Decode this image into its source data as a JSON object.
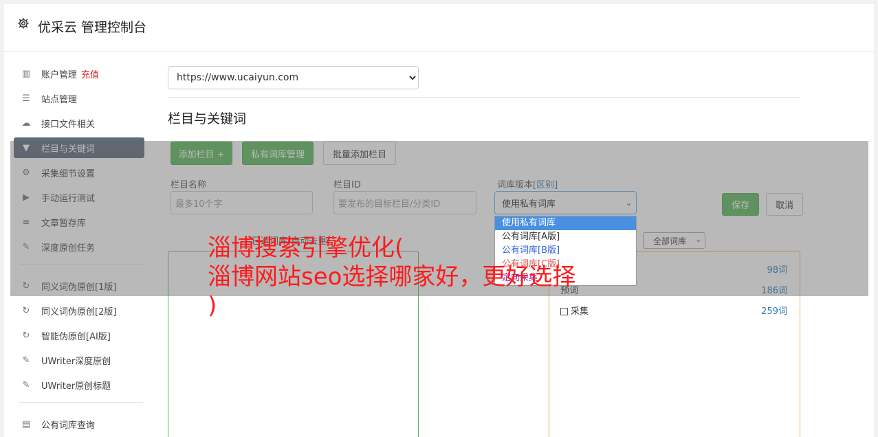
{
  "header": {
    "title": "优采云 管理控制台",
    "icon": "gear-icon"
  },
  "sidebar": {
    "items": [
      {
        "label": "账户管理",
        "badge": "充值",
        "icon": "bar-chart-icon"
      },
      {
        "label": "站点管理",
        "icon": "server-icon"
      },
      {
        "label": "接口文件相关",
        "icon": "cloud-upload-icon"
      },
      {
        "label": "栏目与关键词",
        "icon": "filter-icon",
        "active": true
      },
      {
        "label": "采集细节设置",
        "icon": "gears-icon"
      },
      {
        "label": "手动运行测试",
        "icon": "play-icon"
      },
      {
        "label": "文章暂存库",
        "icon": "database-icon"
      },
      {
        "label": "深度原创任务",
        "icon": "edit-icon"
      }
    ],
    "items2": [
      {
        "label": "同义词伪原创[1版]",
        "icon": "refresh-icon"
      },
      {
        "label": "同义词伪原创[2版]",
        "icon": "refresh-icon"
      },
      {
        "label": "智能伪原创[AI版]",
        "icon": "refresh-icon"
      },
      {
        "label": "UWriter深度原创",
        "icon": "edit-icon"
      },
      {
        "label": "UWriter原创标题",
        "icon": "edit-icon"
      }
    ],
    "items3": [
      {
        "label": "公有词库查询",
        "icon": "book-icon"
      }
    ]
  },
  "main": {
    "site_select": "https://www.ucaiyun.com",
    "section_title": "栏目与关键词",
    "buttons": {
      "add_column": "添加栏目 +",
      "private_lib": "私有词库管理",
      "batch_add": "批量添加栏目"
    },
    "fields": {
      "column_name_label": "栏目名称",
      "column_name_placeholder": "最多10个字",
      "column_id_label": "栏目ID",
      "column_id_placeholder": "要发布的目标栏目/分类ID",
      "version_label": "词库版本",
      "version_diff": "[区别]",
      "version_value": "使用私有词库"
    },
    "version_options": [
      "使用私有词库",
      "公有词库[A版]",
      "公有词库[B版]",
      "公有词库[C版]",
      "定向采集"
    ],
    "save_label": "保存",
    "cancel_label": "取消",
    "selected_label": "已选词库(自动去重)",
    "lib_filter": "全部词库",
    "libraries": [
      {
        "name": "",
        "count": "98词"
      },
      {
        "name": "预词",
        "count": "186词"
      },
      {
        "name": "采集",
        "count": "259词"
      }
    ]
  },
  "promo": {
    "line1": "淄博搜索引擎优化(",
    "line2": "淄博网站seo选择哪家好，更好选择",
    "line3": ")"
  },
  "colors": {
    "accent_green": "#5cb85c",
    "promo_red": "#ff1a1a",
    "active_nav": "#5e6b7a"
  }
}
